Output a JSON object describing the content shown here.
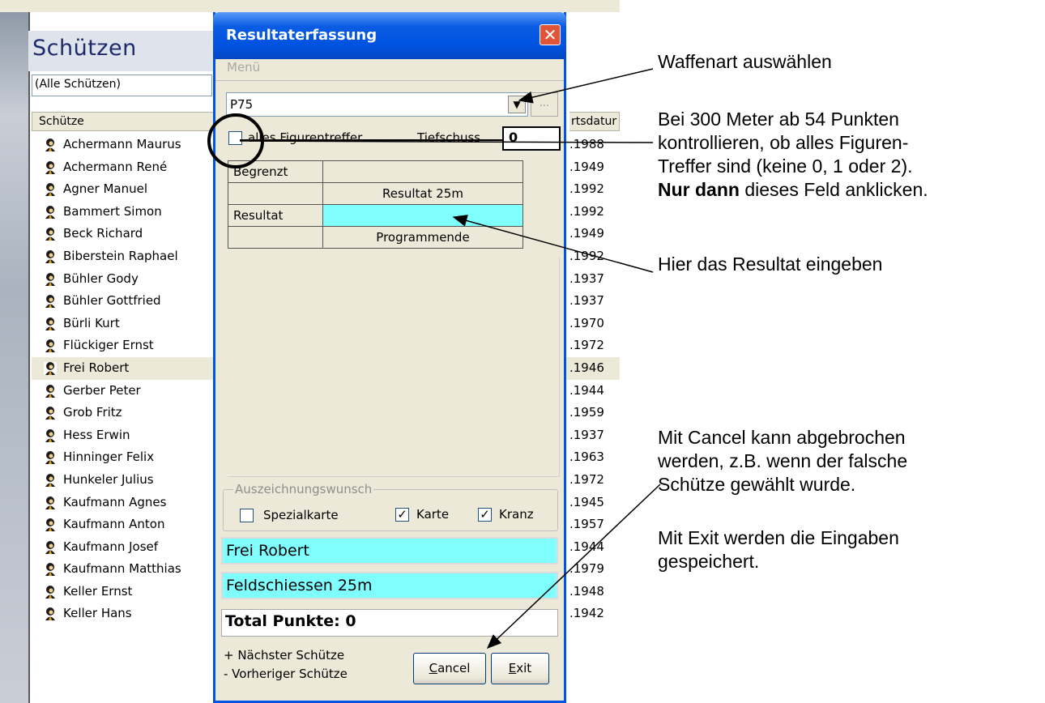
{
  "app": {
    "title": "Schützen",
    "filter": "(Alle Schützen)",
    "col_name": "Schütze",
    "col_date": "rtsdatur",
    "rows": [
      {
        "name": "Achermann Maurus",
        "date": ".1988"
      },
      {
        "name": "Achermann René",
        "date": ".1949"
      },
      {
        "name": "Agner  Manuel",
        "date": ".1992"
      },
      {
        "name": "Bammert  Simon",
        "date": ".1992"
      },
      {
        "name": "Beck Richard",
        "date": ".1949"
      },
      {
        "name": "Biberstein Raphael",
        "date": ".1992"
      },
      {
        "name": "Bühler Gody",
        "date": ".1937"
      },
      {
        "name": "Bühler Gottfried",
        "date": ".1937"
      },
      {
        "name": "Bürli  Kurt",
        "date": ".1970"
      },
      {
        "name": "Flückiger Ernst",
        "date": ".1972"
      },
      {
        "name": "Frei Robert",
        "date": ".1946",
        "selected": true
      },
      {
        "name": "Gerber Peter",
        "date": ".1944"
      },
      {
        "name": "Grob Fritz",
        "date": ".1959"
      },
      {
        "name": "Hess Erwin",
        "date": ".1937"
      },
      {
        "name": "Hinninger Felix",
        "date": ".1963"
      },
      {
        "name": "Hunkeler Julius",
        "date": ".1972"
      },
      {
        "name": "Kaufmann Agnes",
        "date": ".1945"
      },
      {
        "name": "Kaufmann Anton",
        "date": ".1957"
      },
      {
        "name": "Kaufmann Josef",
        "date": ".1944"
      },
      {
        "name": "Kaufmann Matthias",
        "date": ".1979"
      },
      {
        "name": "Keller Ernst",
        "date": ".1948"
      },
      {
        "name": "Keller Hans",
        "date": ".1942"
      }
    ]
  },
  "dialog": {
    "title": "Resultaterfassung",
    "close_label": "✕",
    "menu": "Menü",
    "weapon": "P75",
    "ellipsis": "...",
    "alles_label": "alles Figurentreffer",
    "tief_label": "Tiefschuss",
    "tief_value": "0",
    "grid": {
      "begrenzt": "Begrenzt",
      "resultat_25m": "Resultat 25m",
      "resultat": "Resultat",
      "programmende": "Programmende"
    },
    "award_group": "Auszeichnungswunsch",
    "spezialkarte": "Spezialkarte",
    "karte": "Karte",
    "kranz": "Kranz",
    "shooter": "Frei Robert",
    "program": "Feldschiessen 25m",
    "total": "Total Punkte: 0",
    "next": "+ Nächster Schütze",
    "prev": "- Vorheriger Schütze",
    "cancel_u": "C",
    "cancel_rest": "ancel",
    "exit_u": "E",
    "exit_rest": "xit"
  },
  "annotations": {
    "note1": "Waffenart auswählen",
    "note2_l1": "Bei 300 Meter ab 54 Punkten",
    "note2_l2": "kontrollieren, ob alles Figuren-",
    "note2_l3": "Treffer sind (keine 0, 1 oder 2).",
    "note2_bold": "Nur dann",
    "note2_l4": " dieses Feld anklicken.",
    "note3": "Hier das Resultat eingeben",
    "note4_l1": "Mit Cancel kann abgebrochen",
    "note4_l2": "werden, z.B. wenn der falsche",
    "note4_l3": "Schütze gewählt wurde.",
    "note5_l1": "Mit Exit werden die Eingaben",
    "note5_l2": "gespeichert."
  },
  "colors": {
    "accent": "#0054e3",
    "cyan": "#80ffff",
    "selected_row": "#ece9d8"
  }
}
